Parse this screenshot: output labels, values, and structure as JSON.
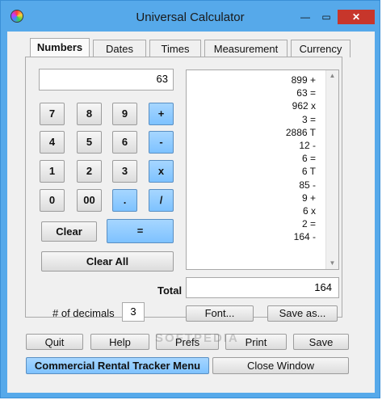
{
  "window": {
    "title": "Universal Calculator",
    "min": "—",
    "max": "▭",
    "close": "✕"
  },
  "tabs": [
    {
      "label": "Numbers"
    },
    {
      "label": "Dates"
    },
    {
      "label": "Times"
    },
    {
      "label": "Measurement"
    },
    {
      "label": "Currency"
    }
  ],
  "display": {
    "value": "63"
  },
  "keys": {
    "k7": "7",
    "k8": "8",
    "k9": "9",
    "plus": "+",
    "k4": "4",
    "k5": "5",
    "k6": "6",
    "minus": "-",
    "k1": "1",
    "k2": "2",
    "k3": "3",
    "times": "x",
    "k0": "0",
    "k00": "00",
    "dot": ".",
    "divide": "/",
    "clear": "Clear",
    "equals": "=",
    "clear_all": "Clear All"
  },
  "tape": [
    "899 +",
    "63 =",
    "962 x",
    "3 =",
    "2886 T",
    "12 -",
    "6 =",
    "6 T",
    "85 -",
    "9 +",
    "6 x",
    "2 =",
    "164 -"
  ],
  "total": {
    "label": "Total",
    "value": "164"
  },
  "decimals": {
    "label": "# of decimals",
    "value": "3"
  },
  "buttons": {
    "font": "Font...",
    "save_as": "Save as...",
    "quit": "Quit",
    "help": "Help",
    "prefs": "Prefs",
    "print": "Print",
    "save": "Save",
    "commercial": "Commercial Rental Tracker Menu",
    "close_window": "Close Window"
  },
  "watermark": "SOFTPEDIA"
}
